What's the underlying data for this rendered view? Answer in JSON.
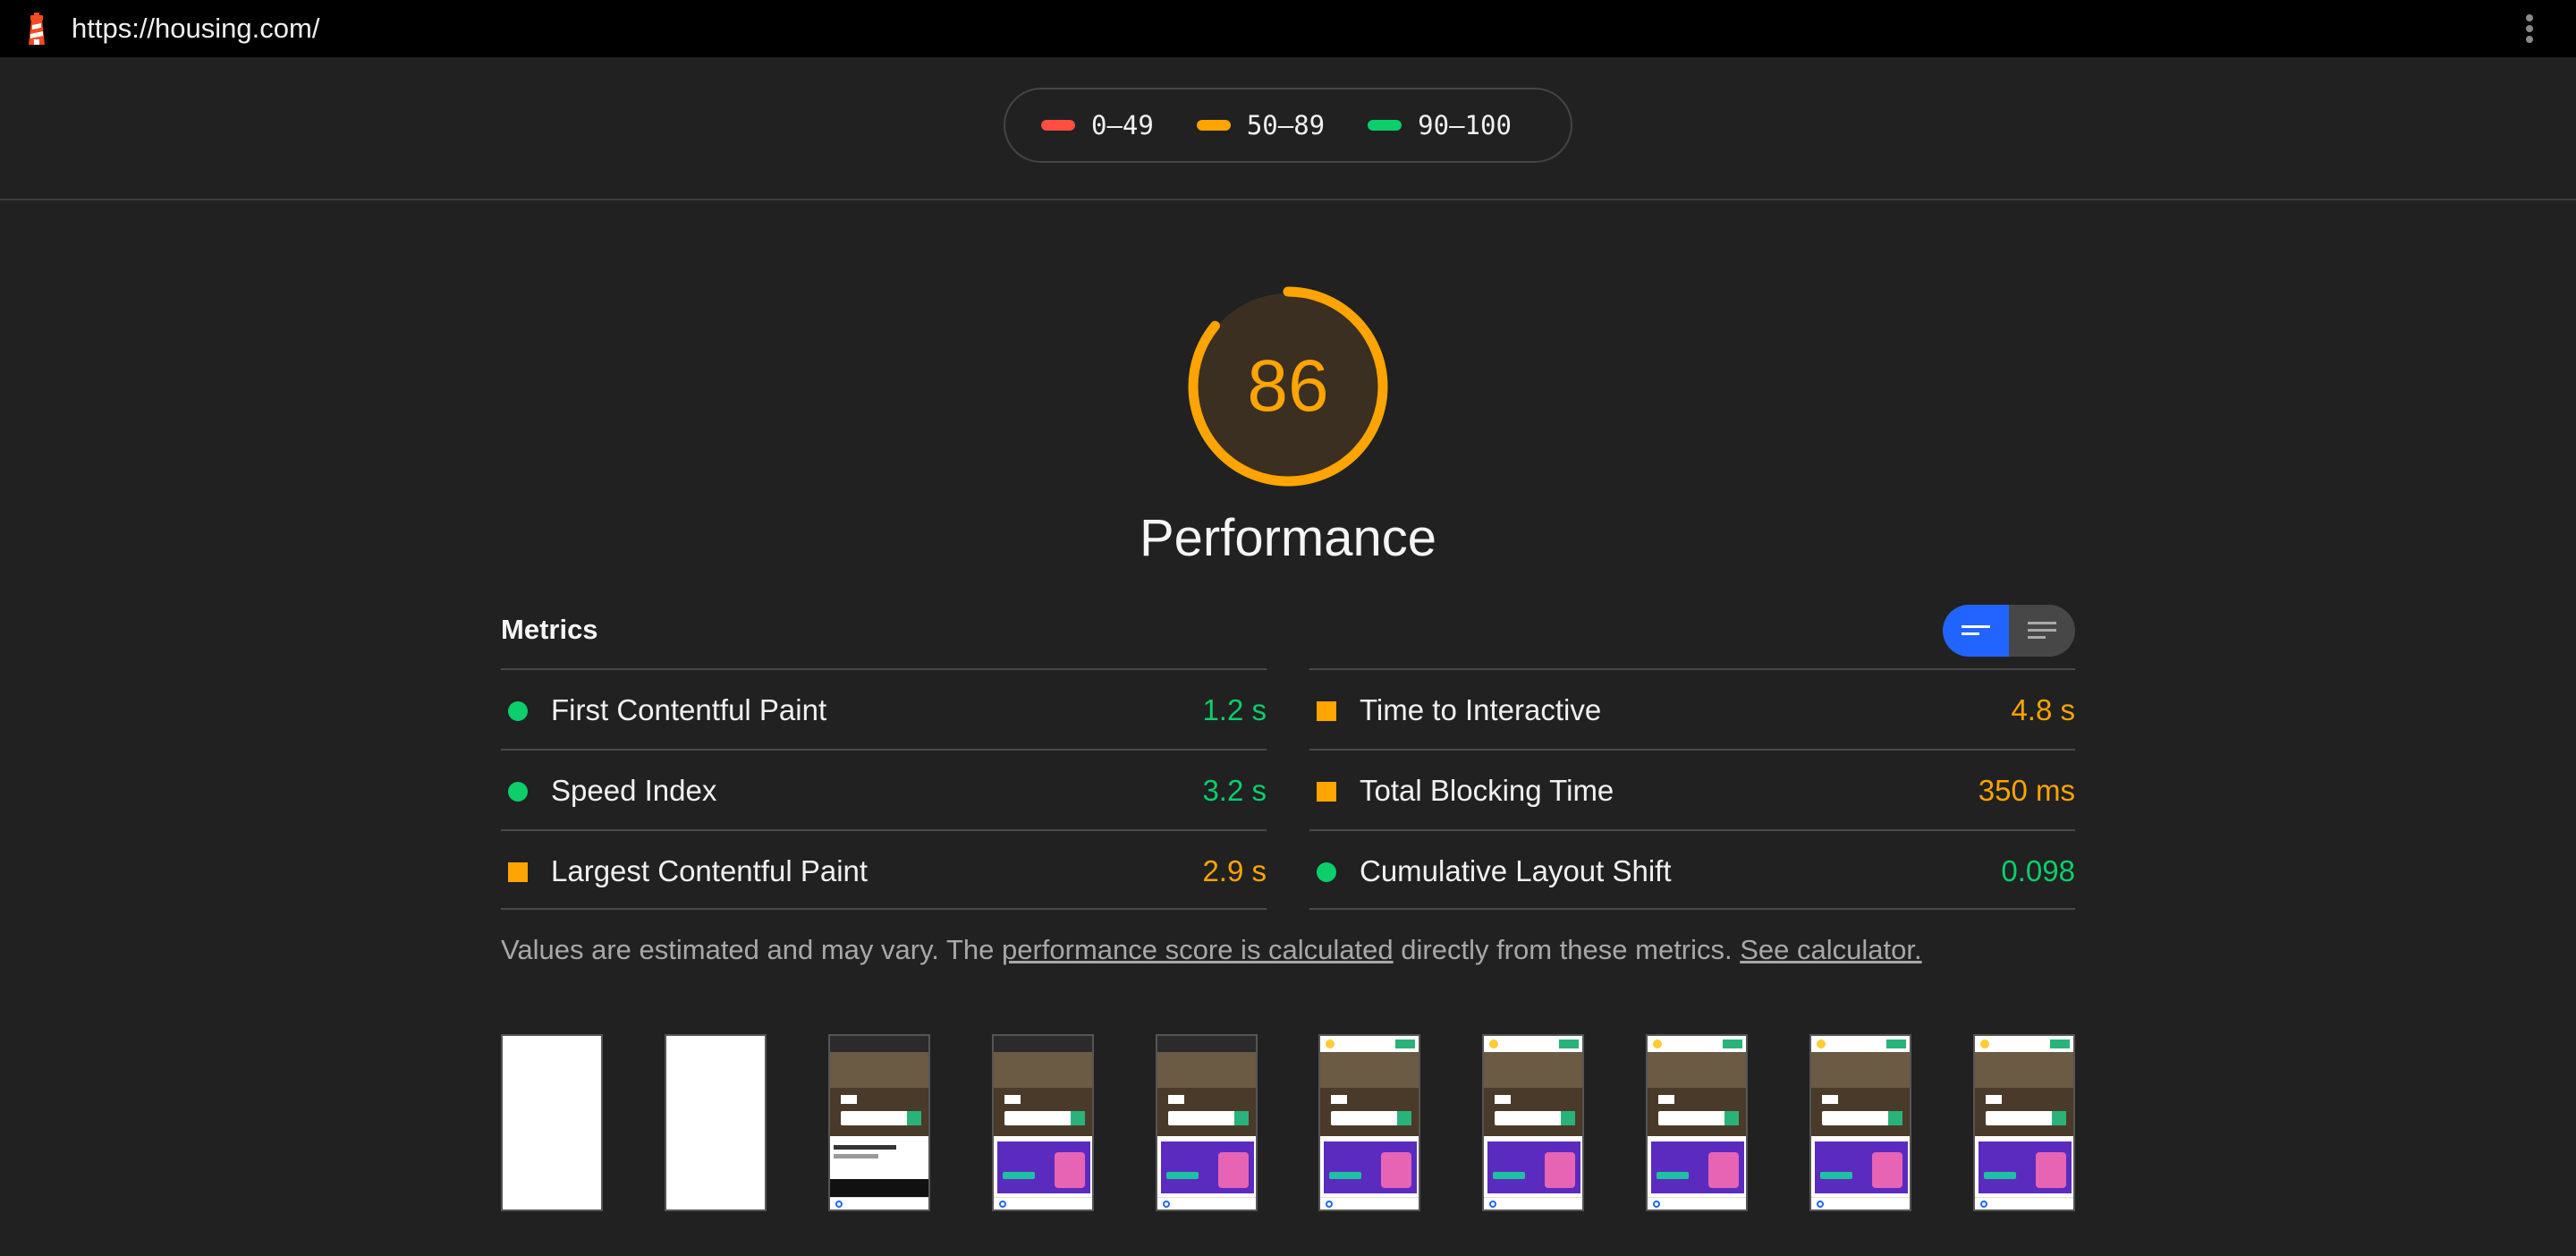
{
  "browser": {
    "url": "https://housing.com/",
    "logo_icon": "lighthouse-icon",
    "menu_icon": "kebab-menu-icon"
  },
  "legend": {
    "items": [
      {
        "label": "0–49",
        "color": "#ff4e42"
      },
      {
        "label": "50–89",
        "color": "#ffa400"
      },
      {
        "label": "90–100",
        "color": "#0cce6b"
      }
    ]
  },
  "gauge": {
    "score": "86",
    "score_value": 86,
    "title": "Performance",
    "color": "#ffa400"
  },
  "metrics": {
    "heading": "Metrics",
    "toggle_icons": [
      "lines-icon",
      "expanded-lines-icon"
    ],
    "left": [
      {
        "name": "First Contentful Paint",
        "value": "1.2 s",
        "status": "pass"
      },
      {
        "name": "Speed Index",
        "value": "3.2 s",
        "status": "pass"
      },
      {
        "name": "Largest Contentful Paint",
        "value": "2.9 s",
        "status": "average"
      }
    ],
    "right": [
      {
        "name": "Time to Interactive",
        "value": "4.8 s",
        "status": "average"
      },
      {
        "name": "Total Blocking Time",
        "value": "350 ms",
        "status": "average"
      },
      {
        "name": "Cumulative Layout Shift",
        "value": "0.098",
        "status": "pass"
      }
    ],
    "colors": {
      "pass": "#0cce6b",
      "average": "#ffa400"
    }
  },
  "note": {
    "prefix": "Values are estimated and may vary. The ",
    "link1": "performance score is calculated",
    "middle": " directly from these metrics. ",
    "link2": "See calculator."
  },
  "filmstrip": {
    "frames": [
      "blank",
      "blank",
      "video",
      "banner",
      "banner",
      "banner-light",
      "banner-light",
      "banner-light",
      "banner-light",
      "banner-light"
    ]
  }
}
